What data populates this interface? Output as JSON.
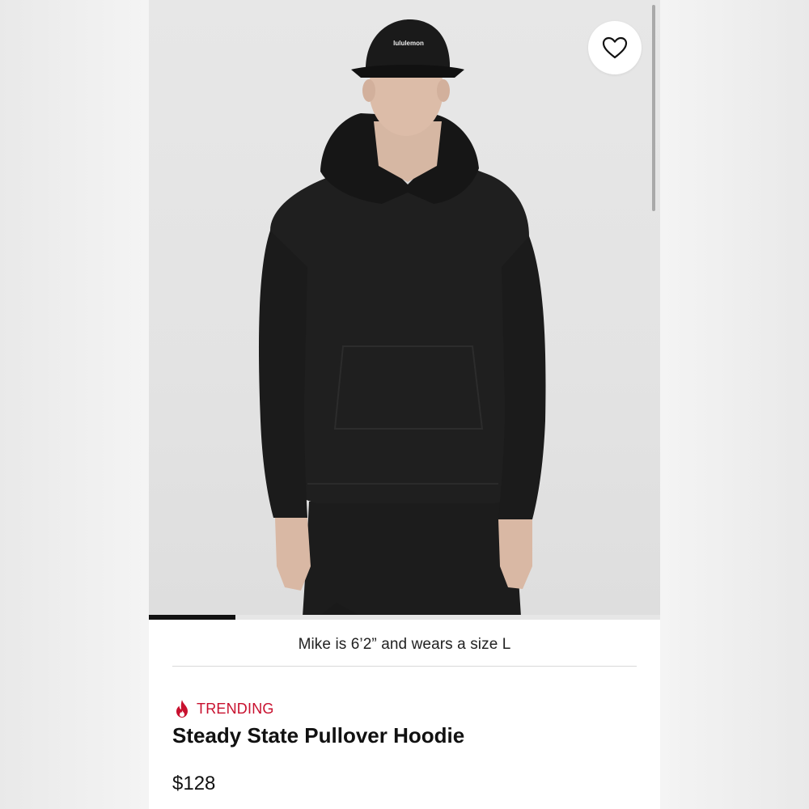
{
  "image": {
    "cap_logo_text": "lululemon"
  },
  "caption": "Mike is 6’2” and wears a size L",
  "badge": {
    "icon": "flame-icon",
    "label": "TRENDING",
    "color": "#c8102e"
  },
  "product": {
    "name": "Steady State Pullover Hoodie",
    "price": "$128"
  },
  "gallery": {
    "progress_fraction": 0.17
  },
  "colors": {
    "background": "#ffffff",
    "text": "#111111",
    "accent": "#c8102e"
  }
}
